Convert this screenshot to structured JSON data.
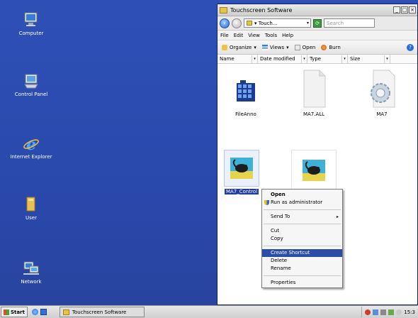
{
  "desktop": {
    "icons": [
      {
        "label": "Computer",
        "icon": "computer-icon"
      },
      {
        "label": "Control Panel",
        "icon": "control-panel-icon"
      },
      {
        "label": "Internet Explorer",
        "icon": "internet-explorer-icon"
      },
      {
        "label": "User",
        "icon": "user-folder-icon"
      },
      {
        "label": "Network",
        "icon": "network-icon"
      }
    ]
  },
  "window": {
    "title": "Touchscreen Software",
    "address": "▾ Touch...",
    "search_placeholder": "Search",
    "menu": [
      "File",
      "Edit",
      "View",
      "Tools",
      "Help"
    ],
    "toolbar": {
      "organize": "Organize",
      "views": "Views",
      "open": "Open",
      "burn": "Burn"
    },
    "columns": [
      "Name",
      "Date modified",
      "Type",
      "Size"
    ],
    "files": [
      {
        "name": "FileAnno",
        "icon": "grid-app-icon"
      },
      {
        "name": "MA7.ALL",
        "icon": "blank-document-icon"
      },
      {
        "name": "MA7",
        "icon": "gear-document-icon"
      },
      {
        "name": "MA7_Control",
        "icon": "mouse-app-icon"
      },
      {
        "name": "",
        "icon": "mouse-app-icon"
      }
    ]
  },
  "context_menu": {
    "items": [
      {
        "label": "Open"
      },
      {
        "label": "Run as administrator"
      },
      {
        "label": "Send To"
      },
      {
        "label": "Cut"
      },
      {
        "label": "Copy"
      },
      {
        "label": "Create Shortcut"
      },
      {
        "label": "Delete"
      },
      {
        "label": "Rename"
      },
      {
        "label": "Properties"
      }
    ]
  },
  "taskbar": {
    "start": "Start",
    "task": "Touchscreen Software",
    "clock": "15:3"
  },
  "colors": {
    "desktop": "#2b4bb0",
    "selection": "#1f3d9e",
    "menu_highlight": "#2a4ea8"
  }
}
